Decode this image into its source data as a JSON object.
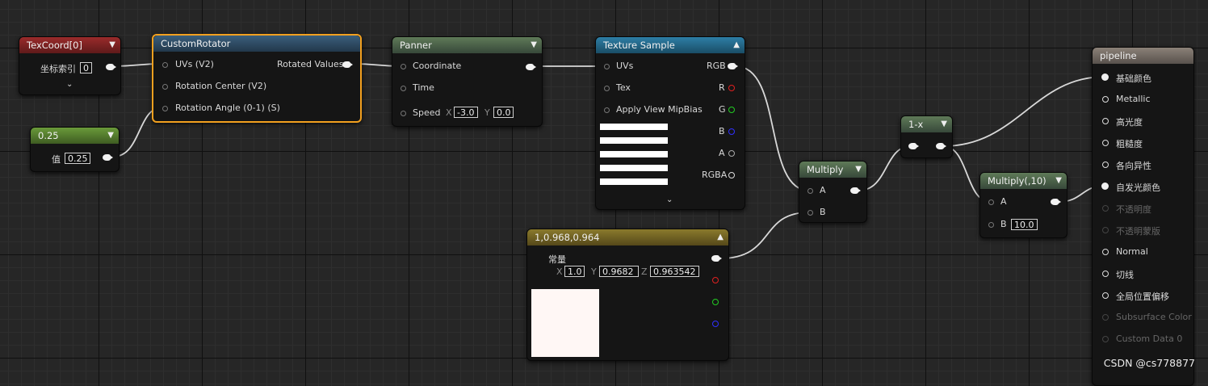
{
  "nodes": {
    "texcoord": {
      "title": "TexCoord[0]",
      "index_label": "坐标索引",
      "index_value": "0"
    },
    "scalar": {
      "title": "0.25",
      "value_label": "值",
      "value": "0.25"
    },
    "customrotator": {
      "title": "CustomRotator",
      "inputs": [
        "UVs (V2)",
        "Rotation Center (V2)",
        "Rotation Angle (0-1) (S)"
      ],
      "output": "Rotated Values"
    },
    "panner": {
      "title": "Panner",
      "inputs": [
        "Coordinate",
        "Time",
        "Speed"
      ],
      "speed_x_label": "X",
      "speed_x": "-3.0",
      "speed_y_label": "Y",
      "speed_y": "0.0"
    },
    "texsample": {
      "title": "Texture Sample",
      "inputs": [
        "UVs",
        "Tex",
        "Apply View MipBias"
      ],
      "outputs": [
        "RGB",
        "R",
        "G",
        "B",
        "A",
        "RGBA"
      ]
    },
    "constant": {
      "title": "1,0.968,0.964",
      "const_label": "常量",
      "x_label": "X",
      "x": "1.0",
      "y_label": "Y",
      "y": "0.9682",
      "z_label": "Z",
      "z": "0.963542",
      "swatch_color": "#fff7f5"
    },
    "multiply1": {
      "title": "Multiply",
      "a_label": "A",
      "b_label": "B"
    },
    "oneminus": {
      "title": "1-x"
    },
    "multiply2": {
      "title": "Multiply(,10)",
      "a_label": "A",
      "b_label": "B",
      "b_value": "10.0"
    },
    "pipeline": {
      "title": "pipeline",
      "pins": [
        {
          "label": "基础颜色",
          "enabled": true
        },
        {
          "label": "Metallic",
          "enabled": true
        },
        {
          "label": "高光度",
          "enabled": true
        },
        {
          "label": "粗糙度",
          "enabled": true
        },
        {
          "label": "各向异性",
          "enabled": true
        },
        {
          "label": "自发光颜色",
          "enabled": true
        },
        {
          "label": "不透明度",
          "enabled": false
        },
        {
          "label": "不透明蒙版",
          "enabled": false
        },
        {
          "label": "Normal",
          "enabled": true
        },
        {
          "label": "切线",
          "enabled": true
        },
        {
          "label": "全局位置偏移",
          "enabled": true
        },
        {
          "label": "Subsurface Color",
          "enabled": false
        },
        {
          "label": "Custom Data 0",
          "enabled": false
        }
      ]
    }
  },
  "watermark": "CSDN @cs778877",
  "colors": {
    "selected_border": "#f2a01f",
    "wire": "#d8d8d8",
    "pin_r": "#e02020",
    "pin_g": "#22cc22",
    "pin_b": "#3030ff"
  }
}
